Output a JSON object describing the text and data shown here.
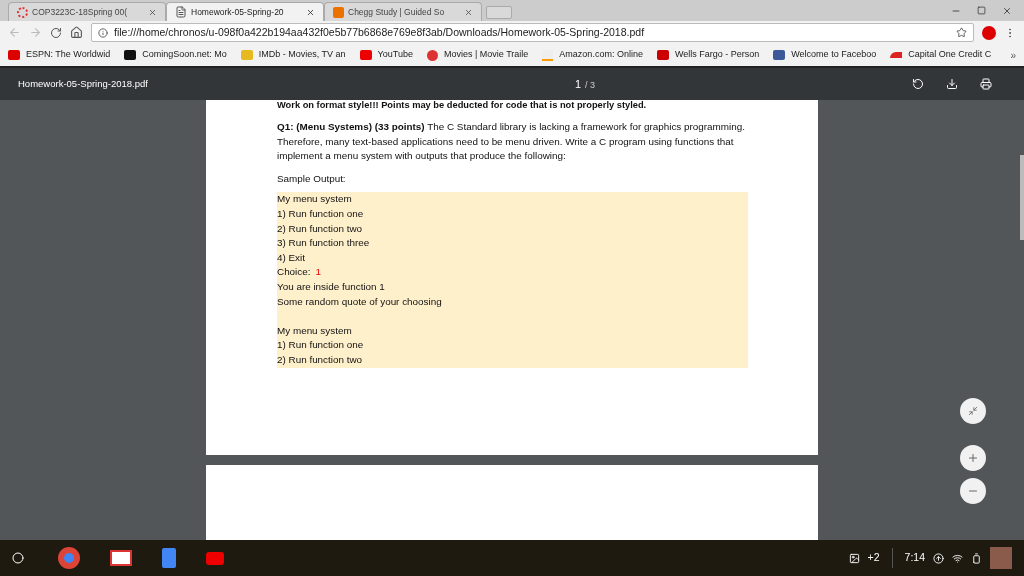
{
  "tabs": [
    {
      "title": "COP3223C-18Spring 00(",
      "selected": false
    },
    {
      "title": "Homework-05-Spring-20",
      "selected": true
    },
    {
      "title": "Chegg Study | Guided So",
      "selected": false
    }
  ],
  "address": {
    "url": "file:///home/chronos/u-098f0a422b194aa432f0e5b77b6868e769e8f3ab/Downloads/Homework-05-Spring-2018.pdf"
  },
  "bookmarks": [
    {
      "label": "ESPN: The Worldwid"
    },
    {
      "label": "ComingSoon.net: Mo"
    },
    {
      "label": "IMDb - Movies, TV an"
    },
    {
      "label": "YouTube"
    },
    {
      "label": "Movies | Movie Traile"
    },
    {
      "label": "Amazon.com: Online"
    },
    {
      "label": "Wells Fargo - Person"
    },
    {
      "label": "Welcome to Faceboo"
    },
    {
      "label": "Capital One Credit C"
    }
  ],
  "bookmarks_overflow": "»",
  "pdf_toolbar": {
    "filename": "Homework-05-Spring-2018.pdf",
    "page": "1",
    "total": "/ 3"
  },
  "document": {
    "cut_heading": "Work on format style!!! Points may be deducted for code that is not properly styled.",
    "question": "**Q1: (Menu Systems) (33 points)** The C Standard library is lacking a framework for graphics programming. Therefore, many text-based applications need to be menu driven. Write a C program using functions that implement a menu system with outputs that produce the following:",
    "sample_label": "Sample Output:",
    "output_blocks": [
      {
        "lines": [
          {
            "text": "My menu system"
          },
          {
            "text": "1) Run function one"
          },
          {
            "text": "2) Run function two"
          },
          {
            "text": "3) Run function three"
          },
          {
            "text": "4) Exit"
          },
          {
            "text": "Choice:",
            "input": "1"
          },
          {
            "text": "You are inside function 1"
          },
          {
            "text": "Some random quote of your choosing"
          }
        ]
      },
      {
        "lines": [
          {
            "text": "My menu system"
          },
          {
            "text": "1) Run function one"
          },
          {
            "text": "2) Run function two"
          }
        ]
      }
    ]
  },
  "taskbar": {
    "notification_count": "+2",
    "time": "7:14"
  }
}
